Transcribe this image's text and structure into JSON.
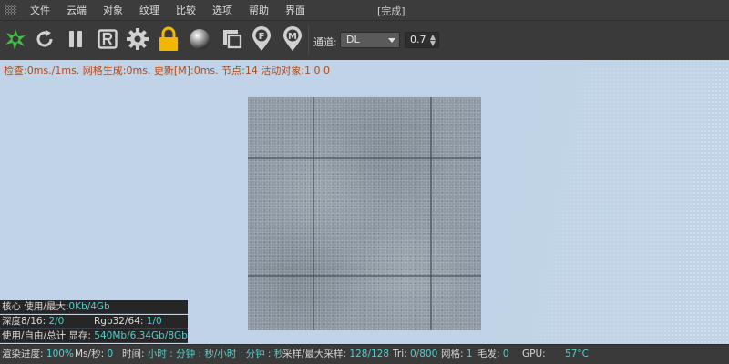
{
  "menu": {
    "items": [
      "文件",
      "云端",
      "对象",
      "纹理",
      "比较",
      "选项",
      "帮助",
      "界面"
    ],
    "status": "[完成]"
  },
  "toolbar": {
    "channel_label": "通道:",
    "channel_value": "DL",
    "value": "0.7",
    "icons": [
      "octane-logo-icon",
      "refresh-icon",
      "pause-icon",
      "r-region-icon",
      "gear-icon",
      "lock-icon",
      "material-sphere-icon",
      "viewport-region-icon",
      "focus-pin-icon",
      "material-pin-icon"
    ],
    "colors": {
      "logo": "#3fbf3f",
      "lock": "#f2b705"
    }
  },
  "viewport": {
    "perf_text": "检查:0ms./1ms. 网格生成:0ms. 更新[M]:0ms. 节点:14 活动对象:1  0 0",
    "background": "#c1d3e6"
  },
  "stats": {
    "core_label": "核心 使用/最大:",
    "core_value": "0Kb/4Gb",
    "depth_label": "深度8/16:",
    "depth_value": "2/0",
    "rgb_label": "Rgb32/64:",
    "rgb_value": "1/0",
    "mem_label": "使用/自由/总计 显存:",
    "mem_value": "540Mb/6.34Gb/8Gb"
  },
  "status": {
    "progress_label": "渲染进度:",
    "progress_value": "100%",
    "ms_label": "Ms/秒:",
    "ms_value": "0",
    "time_label": "时间:",
    "time_value": "小时 : 分钟 : 秒/小时 : 分钟 : 秒",
    "samples_label": "采样/最大采样:",
    "samples_value": "128/128",
    "tri_label": "Tri:",
    "tri_value": "0/800",
    "mesh_label": "网格:",
    "mesh_value": "1",
    "hair_label": "毛发:",
    "hair_value": "0",
    "gpu_label": "GPU:",
    "gpu_value": "57°C"
  }
}
